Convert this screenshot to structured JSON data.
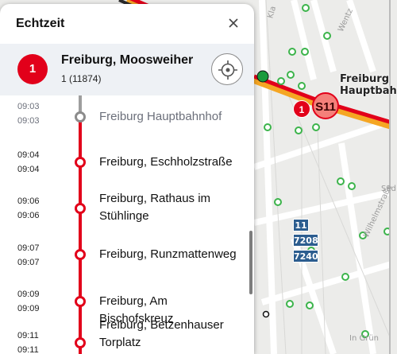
{
  "panel": {
    "title": "Echtzeit",
    "vehicle": {
      "line": "1",
      "destination": "Freiburg, Moosweiher",
      "id": "1 (11874)"
    },
    "stops": [
      {
        "arr": "09:03",
        "dep": "09:03",
        "name": "Freiburg Hauptbahnhof",
        "passed": true
      },
      {
        "arr": "09:04",
        "dep": "09:04",
        "name": "Freiburg, Eschholzstraße",
        "passed": false
      },
      {
        "arr": "09:06",
        "dep": "09:06",
        "name": "Freiburg, Rathaus im Stühlinge",
        "passed": false
      },
      {
        "arr": "09:07",
        "dep": "09:07",
        "name": "Freiburg, Runzmattenweg",
        "passed": false
      },
      {
        "arr": "09:09",
        "dep": "09:09",
        "name": "Freiburg, Am Bischofskreuz",
        "passed": false
      },
      {
        "arr": "09:11",
        "dep": "09:11",
        "name": "Freiburg, Betzenhauser Torplatz",
        "passed": false
      }
    ]
  },
  "map": {
    "station_label": "Freiburg Hauptbahnhof",
    "station_label_line1": "Freiburg",
    "station_label_line2": "Hauptbahnhof",
    "badge_tram": "1",
    "badge_sbahn": "S11",
    "bus_routes": [
      "11",
      "7208",
      "7240"
    ],
    "street_labels": {
      "wentz": "Wentz",
      "kla": "Kla",
      "sed": "Sed",
      "wilhelm": "Wilhelmstraße",
      "grun": "In Grün"
    }
  }
}
